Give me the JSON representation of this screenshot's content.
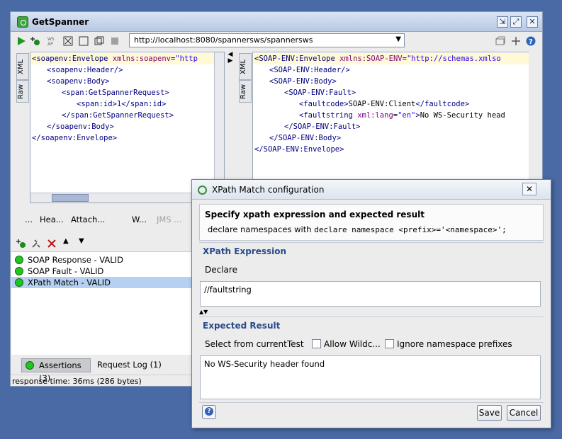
{
  "window": {
    "title": "GetSpanner",
    "url": "http://localhost:8080/spannersws/spannersws"
  },
  "request": {
    "side_tabs": [
      "XML",
      "Raw"
    ],
    "lines": [
      "<soapenv:Envelope xmlns:soapenv=\"http",
      "<soapenv:Header/>",
      "<soapenv:Body>",
      "<span:GetSpannerRequest>",
      "<span:id>1</span:id>",
      "</span:GetSpannerRequest>",
      "</soapenv:Body>",
      "</soapenv:Envelope>"
    ]
  },
  "response": {
    "side_tabs": [
      "XML",
      "Raw"
    ],
    "lines": [
      "<SOAP-ENV:Envelope xmlns:SOAP-ENV=\"http://schemas.xmlso",
      "<SOAP-ENV:Header/>",
      "<SOAP-ENV:Body>",
      "<SOAP-ENV:Fault>",
      "<faultcode>SOAP-ENV:Client</faultcode>",
      "<faultstring xml:lang=\"en\">No WS-Security head",
      "</SOAP-ENV:Fault>",
      "</SOAP-ENV:Body>",
      "</SOAP-ENV:Envelope>"
    ]
  },
  "editor_tabs": [
    "...",
    "Hea...",
    "Attach...",
    "W...",
    "JMS ..."
  ],
  "assertions": {
    "items": [
      "SOAP Response - VALID",
      "SOAP Fault - VALID",
      "XPath Match - VALID"
    ],
    "selected_index": 2
  },
  "bottom_tabs": {
    "assertions": "Assertions (3)",
    "request_log": "Request Log (1)"
  },
  "status": "response time: 36ms (286 bytes)",
  "dialog": {
    "title": "XPath Match configuration",
    "heading": "Specify xpath expression and expected result",
    "subheading_prefix": "declare namespaces with",
    "subheading_code": "declare namespace <prefix>='<namespace>';",
    "xpath_section": "XPath Expression",
    "declare_button": "Declare",
    "xpath_value": "//faultstring",
    "expected_section": "Expected Result",
    "select_from_current": "Select from current",
    "test": "Test",
    "allow_wildcards": "Allow Wildc...",
    "ignore_ns": "Ignore namespace prefixes",
    "expected_value": "No WS-Security header found",
    "save": "Save",
    "cancel": "Cancel"
  },
  "colors": {
    "desktop": "#4a6aa5",
    "valid_dot": "#21c521",
    "selection": "#b5d0f0",
    "section_title": "#2a4a8c"
  }
}
